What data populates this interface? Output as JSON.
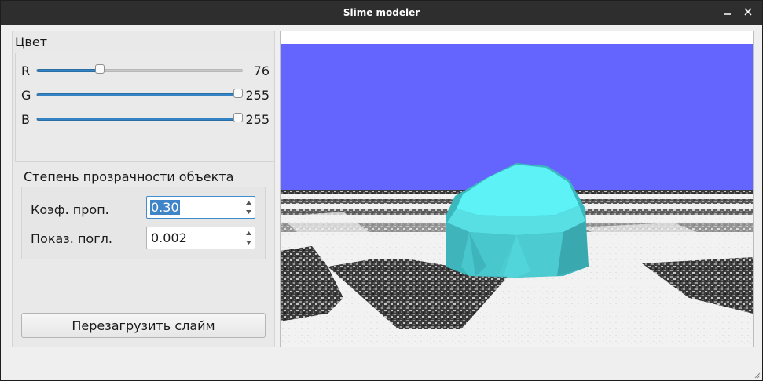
{
  "window": {
    "title": "Slime modeler"
  },
  "color_group": {
    "title": "Цвет",
    "sliders": [
      {
        "label": "R",
        "value": "76",
        "fraction": 0.298
      },
      {
        "label": "G",
        "value": "255",
        "fraction": 1.0
      },
      {
        "label": "B",
        "value": "255",
        "fraction": 1.0
      }
    ],
    "accent": "#3585c6"
  },
  "transparency_group": {
    "title": "Степень прозрачности объекта",
    "fields": [
      {
        "label": "Коэф.  проп.",
        "value": "0.30",
        "selected": true
      },
      {
        "label": "Показ. погл.",
        "value": "0.002",
        "selected": false
      }
    ]
  },
  "reload_button": {
    "label": "Перезагрузить слайм"
  },
  "scene": {
    "sky_color": "#6464ff",
    "object_color": "#5ef0f4",
    "floor": "checkerboard"
  }
}
